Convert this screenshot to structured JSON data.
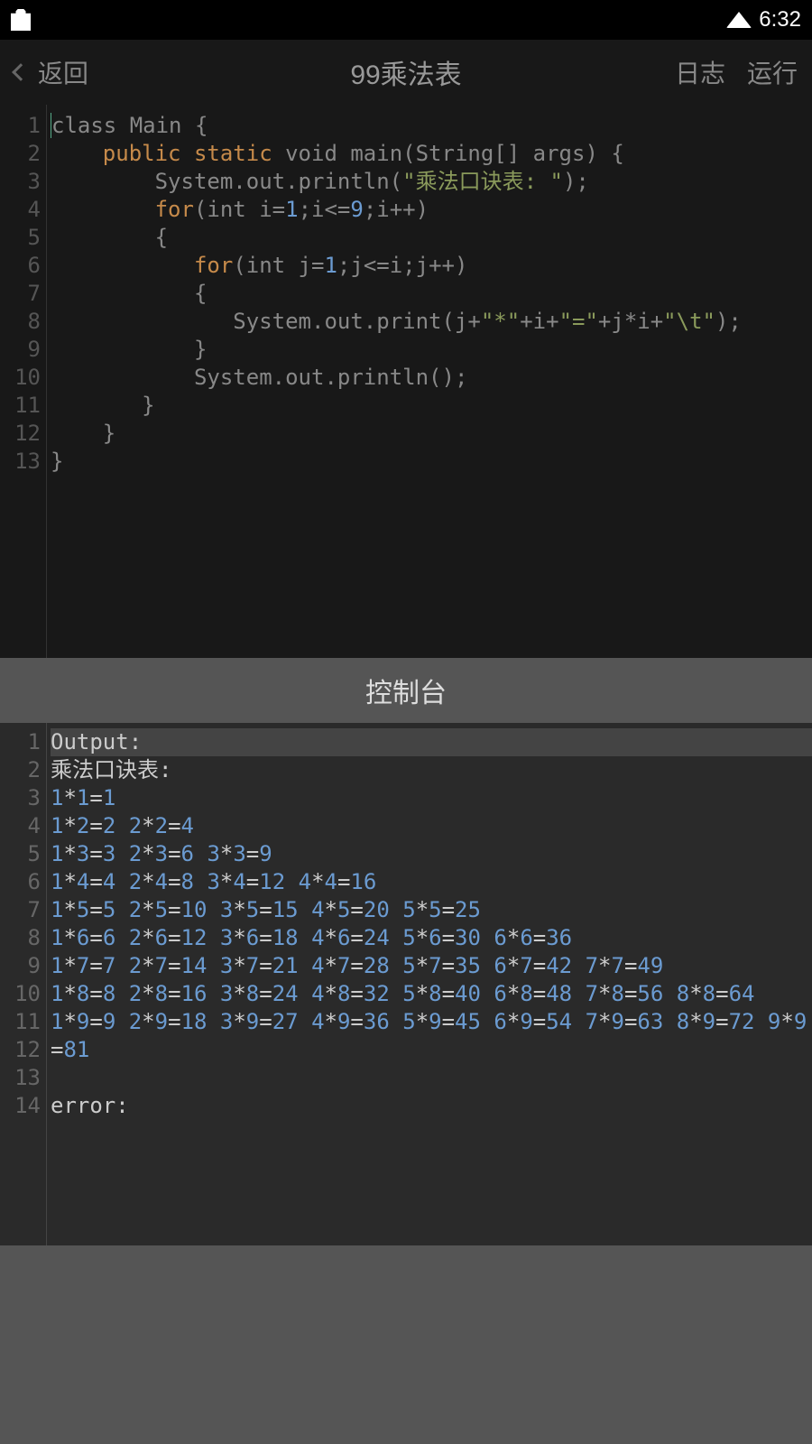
{
  "status": {
    "time": "6:32"
  },
  "header": {
    "back": "返回",
    "title": "99乘法表",
    "log": "日志",
    "run": "运行"
  },
  "code": {
    "lines": [
      {
        "n": 1
      },
      {
        "n": 2
      },
      {
        "n": 3
      },
      {
        "n": 4
      },
      {
        "n": 5
      },
      {
        "n": 6
      },
      {
        "n": 7
      },
      {
        "n": 8
      },
      {
        "n": 9
      },
      {
        "n": 10
      },
      {
        "n": 11
      },
      {
        "n": 12
      },
      {
        "n": 13
      }
    ],
    "tokens": {
      "class": "class",
      "Main": "Main",
      "public": "public",
      "static": "static",
      "void": "void",
      "main": "main",
      "String": "String",
      "args": "args",
      "System": "System",
      "out": "out",
      "println": "println",
      "print": "print",
      "str1": "\"乘法口诀表: \"",
      "for": "for",
      "int": "int",
      "i": "i",
      "j": "j",
      "n1": "1",
      "n9": "9",
      "star": "\"*\"",
      "eq": "\"=\"",
      "tab": "\"\\t\""
    }
  },
  "console": {
    "title": "控制台",
    "lines": [
      {
        "n": 1
      },
      {
        "n": 2
      },
      {
        "n": 3
      },
      {
        "n": 4
      },
      {
        "n": 5
      },
      {
        "n": 6
      },
      {
        "n": 7
      },
      {
        "n": 8
      },
      {
        "n": 9
      },
      {
        "n": 10
      },
      {
        "n": 11
      },
      {
        "n": 12
      },
      {
        "n": 13
      },
      {
        "n": 14
      }
    ],
    "output_label": "Output:",
    "heading": "乘法口诀表: ",
    "table": [
      [
        [
          1,
          1,
          1
        ]
      ],
      [
        [
          1,
          2,
          2
        ],
        [
          2,
          2,
          4
        ]
      ],
      [
        [
          1,
          3,
          3
        ],
        [
          2,
          3,
          6
        ],
        [
          3,
          3,
          9
        ]
      ],
      [
        [
          1,
          4,
          4
        ],
        [
          2,
          4,
          8
        ],
        [
          3,
          4,
          12
        ],
        [
          4,
          4,
          16
        ]
      ],
      [
        [
          1,
          5,
          5
        ],
        [
          2,
          5,
          10
        ],
        [
          3,
          5,
          15
        ],
        [
          4,
          5,
          20
        ],
        [
          5,
          5,
          25
        ]
      ],
      [
        [
          1,
          6,
          6
        ],
        [
          2,
          6,
          12
        ],
        [
          3,
          6,
          18
        ],
        [
          4,
          6,
          24
        ],
        [
          5,
          6,
          30
        ],
        [
          6,
          6,
          36
        ]
      ],
      [
        [
          1,
          7,
          7
        ],
        [
          2,
          7,
          14
        ],
        [
          3,
          7,
          21
        ],
        [
          4,
          7,
          28
        ],
        [
          5,
          7,
          35
        ],
        [
          6,
          7,
          42
        ],
        [
          7,
          7,
          49
        ]
      ],
      [
        [
          1,
          8,
          8
        ],
        [
          2,
          8,
          16
        ],
        [
          3,
          8,
          24
        ],
        [
          4,
          8,
          32
        ],
        [
          5,
          8,
          40
        ],
        [
          6,
          8,
          48
        ],
        [
          7,
          8,
          56
        ],
        [
          8,
          8,
          64
        ]
      ],
      [
        [
          1,
          9,
          9
        ],
        [
          2,
          9,
          18
        ],
        [
          3,
          9,
          27
        ],
        [
          4,
          9,
          36
        ],
        [
          5,
          9,
          45
        ],
        [
          6,
          9,
          54
        ],
        [
          7,
          9,
          63
        ],
        [
          8,
          9,
          72
        ],
        [
          9,
          9,
          81
        ]
      ]
    ],
    "error_label": "error:"
  }
}
